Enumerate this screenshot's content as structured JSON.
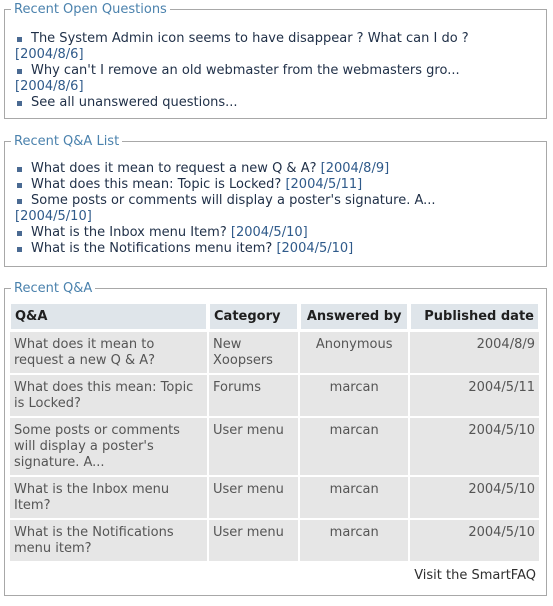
{
  "open_questions": {
    "title": "Recent Open Questions",
    "items": [
      {
        "text": "The System Admin icon seems to have disappear ? What can I do ?",
        "date": "[2004/8/6]"
      },
      {
        "text": "Why can't I remove an old webmaster from the webmasters gro...",
        "date": "[2004/8/6]"
      },
      {
        "text": "See all unanswered questions...",
        "date": ""
      }
    ]
  },
  "qa_list": {
    "title": "Recent Q&A List",
    "items": [
      {
        "text": "What does it mean to request a new Q & A?",
        "date": "[2004/8/9]"
      },
      {
        "text": "What does this mean: Topic is Locked?",
        "date": "[2004/5/11]"
      },
      {
        "text": "Some posts or comments will display a poster's signature. A...",
        "date": "[2004/5/10]"
      },
      {
        "text": "What is the Inbox menu Item?",
        "date": "[2004/5/10]"
      },
      {
        "text": "What is the Notifications menu item?",
        "date": "[2004/5/10]"
      }
    ]
  },
  "recent_qa": {
    "title": "Recent Q&A",
    "headers": {
      "qa": "Q&A",
      "category": "Category",
      "answered_by": "Answered by",
      "published": "Published date"
    },
    "rows": [
      {
        "question": "What does it mean to request a new Q & A?",
        "category": "New Xoopsers",
        "answered_by": "Anonymous",
        "date": "2004/8/9"
      },
      {
        "question": "What does this mean: Topic is Locked?",
        "category": "Forums",
        "answered_by": "marcan",
        "date": "2004/5/11"
      },
      {
        "question": "Some posts or comments will display a poster's signature. A...",
        "category": "User menu",
        "answered_by": "marcan",
        "date": "2004/5/10"
      },
      {
        "question": "What is the Inbox menu Item?",
        "category": "User menu",
        "answered_by": "marcan",
        "date": "2004/5/10"
      },
      {
        "question": "What is the Notifications menu item?",
        "category": "User menu",
        "answered_by": "marcan",
        "date": "2004/5/10"
      }
    ],
    "footer_link": "Visit the SmartFAQ"
  },
  "colors": {
    "legend": "#4b82ad",
    "bullet": "#4a6a92",
    "date": "#2f5a8a",
    "header_bg": "#dfe5ea",
    "row_bg": "#e6e6e6"
  }
}
